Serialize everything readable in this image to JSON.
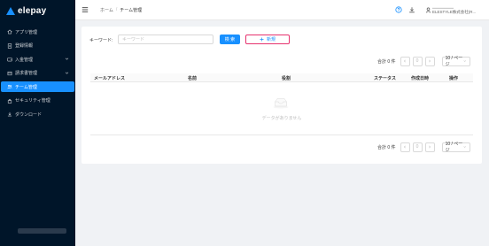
{
  "app": {
    "logo_text": "elepay"
  },
  "sidebar": {
    "items": [
      {
        "label": "アプリ管理",
        "icon": "home-icon"
      },
      {
        "label": "登録情報",
        "icon": "file-icon"
      },
      {
        "label": "入金管理",
        "icon": "wallet-icon",
        "expandable": true
      },
      {
        "label": "請求書管理",
        "icon": "invoice-icon",
        "expandable": true
      },
      {
        "label": "チーム管理",
        "icon": "team-icon",
        "active": true
      },
      {
        "label": "セキュリティ管理",
        "icon": "lock-icon"
      },
      {
        "label": "ダウンロード",
        "icon": "download-icon"
      }
    ]
  },
  "header": {
    "breadcrumb": {
      "home": "ホーム",
      "separator": "/",
      "current": "チーム管理"
    },
    "user": {
      "org": "ELESTYLE株式会社(R..."
    }
  },
  "search": {
    "label": "キーワード:",
    "placeholder": "キーワード",
    "value": "",
    "search_button": "検 索",
    "new_button": "新規",
    "new_button_icon": "plus-icon"
  },
  "pagination": {
    "total": "合計 0 件",
    "current_page": "0",
    "page_size": "10 / ページ"
  },
  "table": {
    "columns": [
      "メールアドレス",
      "名前",
      "役割",
      "ステータス",
      "作成日時",
      "操作"
    ],
    "rows": [],
    "empty_text": "データがありません"
  },
  "colors": {
    "sidebar_bg": "#001529",
    "accent": "#1890ff",
    "new_button_border": "#e6326e"
  }
}
